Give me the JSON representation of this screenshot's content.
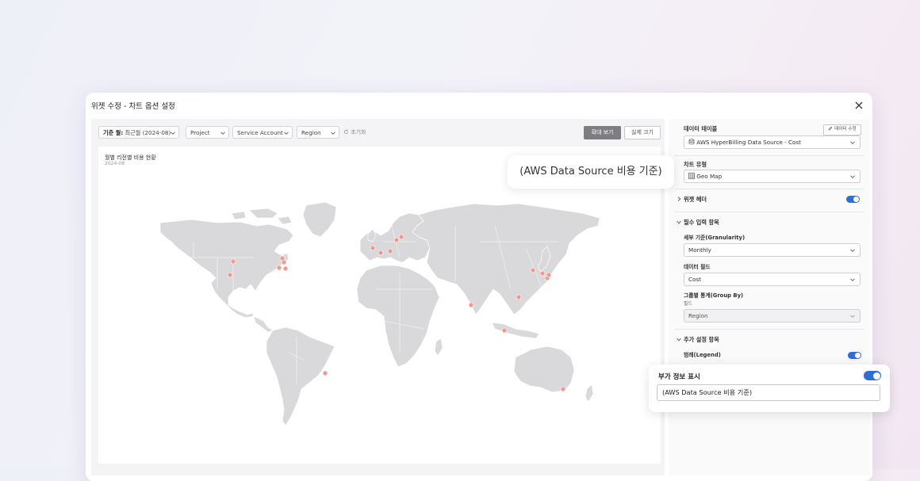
{
  "modal": {
    "title": "위젯 수정 - 차트 옵션 설정"
  },
  "filters": {
    "period_label": "기준 월:",
    "period_value": "최근월 (2024-08)",
    "project": "Project",
    "service_account": "Service Account",
    "region": "Region",
    "reset": "초기화"
  },
  "toolbar": {
    "zoom_view": "확대 보기",
    "actual_size": "실제 크기"
  },
  "chart": {
    "title": "월별 리전별 비용 현황",
    "subtitle": "2024-08"
  },
  "panel": {
    "data_table_label": "데이터 테이블",
    "edit_data_button": "데이터 수정",
    "data_source": "AWS HyperBilling Data Source - Cost",
    "chart_type_label": "차트 유형",
    "chart_type": "Geo Map",
    "widget_header_label": "위젯 헤더",
    "required_section": "필수 입력 항목",
    "granularity_label": "세부 기준(Granularity)",
    "granularity_value": "Monthly",
    "data_field_label": "데이터 필드",
    "data_field_value": "Cost",
    "group_by_label": "그룹별 통계(Group By)",
    "group_by_sub": "필드",
    "group_by_value": "Region",
    "additional_section": "추가 설정 항목",
    "legend_label": "범례(Legend)"
  },
  "callouts": {
    "header_preview": "(AWS Data Source 비용 기준)",
    "additional_info_label": "부가 정보 표시",
    "additional_info_value": "(AWS Data Source 비용 기준)"
  },
  "colors": {
    "accent": "#2d6fd6",
    "marker": "#f2998f",
    "land": "#d9d9dc"
  }
}
